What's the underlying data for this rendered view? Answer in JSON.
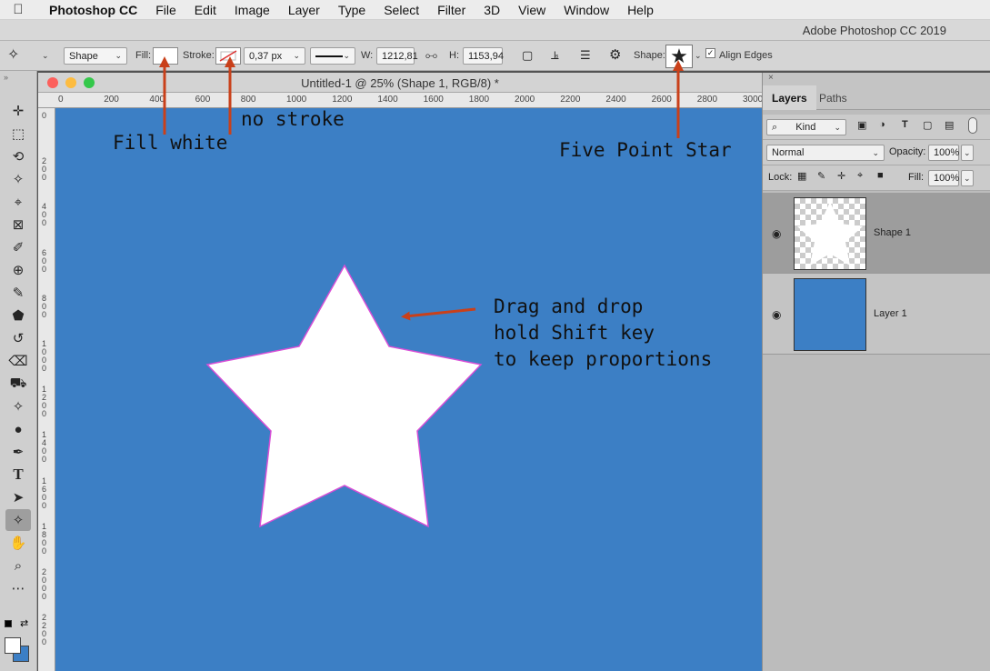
{
  "menubar": {
    "apple": "",
    "app": "Photoshop CC",
    "items": [
      "File",
      "Edit",
      "Image",
      "Layer",
      "Type",
      "Select",
      "Filter",
      "3D",
      "View",
      "Window",
      "Help"
    ]
  },
  "app_title": "Adobe Photoshop CC 2019",
  "options": {
    "mode": "Shape",
    "fill_label": "Fill:",
    "stroke_label": "Stroke:",
    "stroke_width": "0,37 px",
    "w_label": "W:",
    "w_value": "1212,81",
    "h_label": "H:",
    "h_value": "1153,94",
    "shape_label": "Shape:",
    "align_edges": "Align Edges"
  },
  "document": {
    "title": "Untitled-1 @ 25% (Shape 1, RGB/8) *",
    "ruler_h": [
      "0",
      "200",
      "400",
      "600",
      "800",
      "1000",
      "1200",
      "1400",
      "1600",
      "1800",
      "2000",
      "2200",
      "2400",
      "2600",
      "2800",
      "3000"
    ],
    "ruler_v": [
      "0",
      "2 0 0",
      "4 0 0",
      "6 0 0",
      "8 0 0",
      "1 0 0 0",
      "1 2 0 0",
      "1 4 0 0",
      "1 6 0 0",
      "1 8 0 0",
      "2 0 0 0",
      "2 2 0 0"
    ],
    "canvas_color": "#3c7fc5"
  },
  "annotations": {
    "fill": "Fill white",
    "stroke": "no stroke",
    "shape": "Five Point Star",
    "drag": [
      "Drag and drop",
      "hold Shift key",
      "to keep proportions"
    ],
    "arrow_color": "#c9401a"
  },
  "layers_panel": {
    "close": "×",
    "tabs": [
      "Layers",
      "Paths"
    ],
    "kind": "Kind",
    "blend": "Normal",
    "opacity_label": "Opacity:",
    "opacity": "100%",
    "lock_label": "Lock:",
    "fill_label": "Fill:",
    "fill": "100%",
    "layers": [
      {
        "name": "Shape 1",
        "selected": true
      },
      {
        "name": "Layer 1",
        "selected": false
      }
    ]
  }
}
